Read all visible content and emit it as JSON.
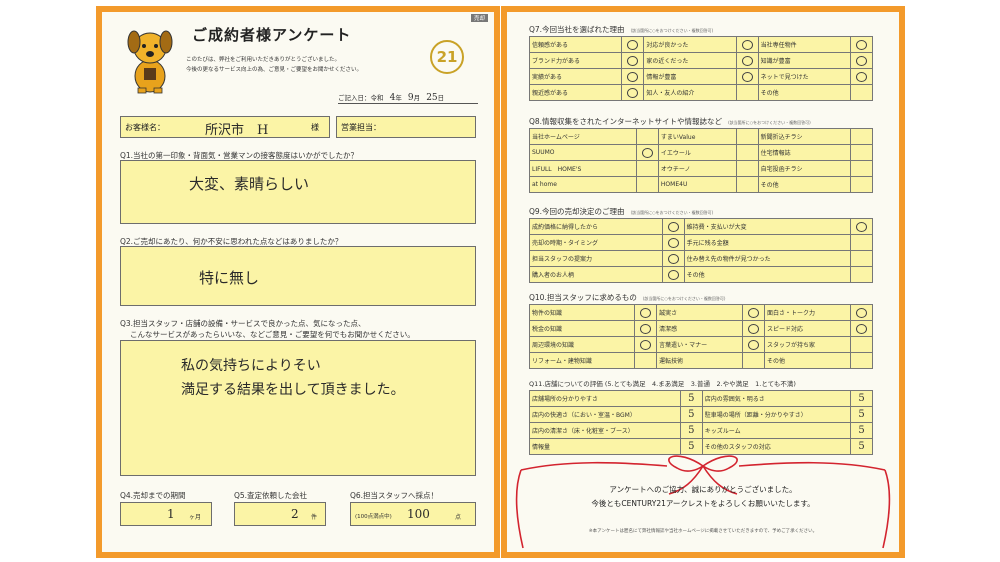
{
  "left": {
    "tag": "売却",
    "title": "ご成約者様アンケート",
    "intro_line1": "このたびは、弊社をご利用いただきありがとうございました。",
    "intro_line2": "今後の更なるサービス向上の為、ご意見・ご要望をお聞かせください。",
    "logo_text": "21",
    "date_label": "ご記入日：令和",
    "date_year": "4",
    "date_year_unit": "年",
    "date_month": "9",
    "date_month_unit": "月",
    "date_day": "25",
    "date_day_unit": "日",
    "customer_label": "お客様名：",
    "customer_value": "所沢市　H",
    "customer_suffix": "様",
    "staff_label": "営業担当：",
    "q1_label": "Q1.当社の第一印象・背面気・営業マンの接客態度はいかがでしたか？",
    "q1_answer": "大変、素晴らしい",
    "q2_label": "Q2.ご売却にあたり、何か不安に思われた点などはありましたか？",
    "q2_answer": "特に無し",
    "q3_label1": "Q3.担当スタッフ・店舗の設備・サービスで良かった点、気になった点、",
    "q3_label2": "こんなサービスがあったらいいな、などご意見・ご要望を何でもお聞かせください。",
    "q3_answer1": "私の気持ちによりそい",
    "q3_answer2": "満足する結果を出して頂きました。",
    "q4_label": "Q4.売却までの期間",
    "q4_value": "1",
    "q4_unit": "ヶ月",
    "q5_label": "Q5.査定依頼した会社",
    "q5_value": "2",
    "q5_unit": "件",
    "q6_label": "Q6.担当スタッフへ採点！",
    "q6_prefix": "(100点満点中)",
    "q6_value": "100",
    "q6_unit": "点"
  },
  "right": {
    "q7_label": "Q7.今回当社を選ばれた理由",
    "q7_note": "(該当箇所に○をおつけください・複数回答可)",
    "q7_rows": [
      [
        {
          "t": "信頼感がある",
          "m": "○"
        },
        {
          "t": "対応が良かった",
          "m": "○"
        },
        {
          "t": "当社専任物件",
          "m": "○"
        }
      ],
      [
        {
          "t": "ブランド力がある",
          "m": "○"
        },
        {
          "t": "家の近くだった",
          "m": "○"
        },
        {
          "t": "知識が豊富",
          "m": "○"
        }
      ],
      [
        {
          "t": "実績がある",
          "m": "○"
        },
        {
          "t": "情報が豊富",
          "m": "○"
        },
        {
          "t": "ネットで見つけた",
          "m": "○"
        }
      ],
      [
        {
          "t": "親近感がある",
          "m": "○"
        },
        {
          "t": "知人・友人の紹介",
          "m": ""
        },
        {
          "t": "その他",
          "m": ""
        }
      ]
    ],
    "q8_label": "Q8.情報収集をされたインターネットサイトや情報誌など",
    "q8_note": "(該当箇所に○をおつけください・複数回答可)",
    "q8_rows": [
      [
        {
          "t": "当社ホームページ",
          "m": ""
        },
        {
          "t": "すまいValue",
          "m": ""
        },
        {
          "t": "新聞折込チラシ",
          "m": ""
        }
      ],
      [
        {
          "t": "SUUMO",
          "m": "○"
        },
        {
          "t": "イエウール",
          "m": ""
        },
        {
          "t": "住宅情報誌",
          "m": ""
        }
      ],
      [
        {
          "t": "LIFULL　HOME'S",
          "m": ""
        },
        {
          "t": "オウチーノ",
          "m": ""
        },
        {
          "t": "自宅投函チラシ",
          "m": ""
        }
      ],
      [
        {
          "t": "at home",
          "m": ""
        },
        {
          "t": "HOME4U",
          "m": ""
        },
        {
          "t": "その他",
          "m": ""
        }
      ]
    ],
    "q9_label": "Q9.今回の売却決定のご理由",
    "q9_note": "(該当箇所に○をおつけください・複数回答可)",
    "q9_rows": [
      [
        {
          "t": "成約価格に納得したから",
          "m": "○"
        },
        {
          "t": "維持費・支払いが大変",
          "m": "○"
        }
      ],
      [
        {
          "t": "売却の時期・タイミング",
          "m": "○"
        },
        {
          "t": "手元に残る金額",
          "m": ""
        }
      ],
      [
        {
          "t": "担当スタッフの提案力",
          "m": "○"
        },
        {
          "t": "住み替え先の物件が見つかった",
          "m": ""
        }
      ],
      [
        {
          "t": "購入者のお人柄",
          "m": "○"
        },
        {
          "t": "その他",
          "m": ""
        }
      ]
    ],
    "q10_label": "Q10.担当スタッフに求めるもの",
    "q10_note": "(該当箇所に○をおつけください・複数回答可)",
    "q10_rows": [
      [
        {
          "t": "物件の知識",
          "m": "○"
        },
        {
          "t": "誠実さ",
          "m": "○"
        },
        {
          "t": "面白さ・トーク力",
          "m": "○"
        }
      ],
      [
        {
          "t": "税金の知識",
          "m": "○"
        },
        {
          "t": "清潔感",
          "m": "○"
        },
        {
          "t": "スピード対応",
          "m": "○"
        }
      ],
      [
        {
          "t": "周辺環境の知識",
          "m": "○"
        },
        {
          "t": "言葉遣い・マナー",
          "m": "○"
        },
        {
          "t": "スタッフが持ち家",
          "m": ""
        }
      ],
      [
        {
          "t": "リフォーム・建物知識",
          "m": ""
        },
        {
          "t": "運転技術",
          "m": ""
        },
        {
          "t": "その他",
          "m": ""
        }
      ]
    ],
    "q11_label": "Q11.店舗についての評価 (5.とても満足　4.まあ満足　3.普通　2.やや満足　1.とても不満)",
    "q11_rows": [
      [
        {
          "t": "店舗場所の分かりやすさ",
          "m": "5"
        },
        {
          "t": "店内の雰囲気・明るさ",
          "m": "5"
        }
      ],
      [
        {
          "t": "店内の快適さ（におい・室温・BGM）",
          "m": "5"
        },
        {
          "t": "駐車場の場所（距離・分かりやすさ）",
          "m": "5"
        }
      ],
      [
        {
          "t": "店内の清潔さ（床・化粧室・ブース）",
          "m": "5"
        },
        {
          "t": "キッズルーム",
          "m": "5"
        }
      ],
      [
        {
          "t": "情報量",
          "m": "5"
        },
        {
          "t": "その他のスタッフの対応",
          "m": "5"
        }
      ]
    ],
    "thanks1": "アンケートへのご協力、誠にありがとうございました。",
    "thanks2": "今後ともCENTURY21アークレストをよろしくお願いいたします。",
    "footnote": "※本アンケートは匿名にて弊社情報誌や当社ホームページに掲載させていただきますので、予めご了承ください。",
    "ribbon_color": "#d3242f"
  },
  "colors": {
    "frame": "#f39a2b",
    "field": "#fbf4a6",
    "logo": "#c9a227"
  }
}
